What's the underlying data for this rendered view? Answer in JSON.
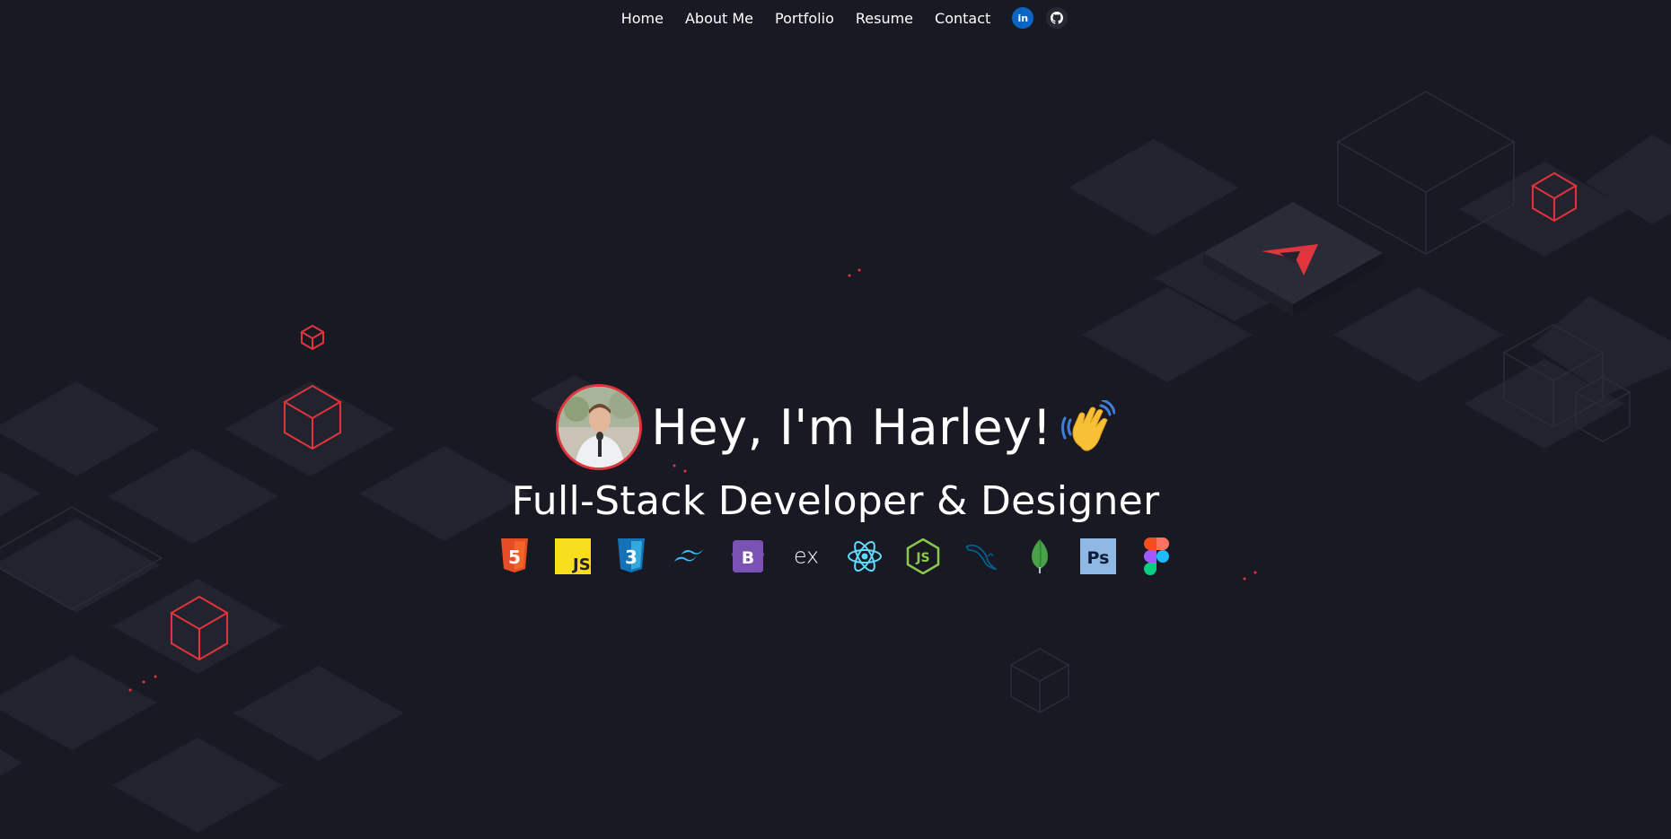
{
  "nav": {
    "items": [
      "Home",
      "About Me",
      "Portfolio",
      "Resume",
      "Contact"
    ],
    "social": [
      {
        "icon": "linkedin-icon",
        "label": "in",
        "color": "#0a66c2"
      },
      {
        "icon": "github-icon",
        "color": "#262832"
      }
    ]
  },
  "hero": {
    "greeting": "Hey, I'm Harley!",
    "emoji": "waving-hand-icon",
    "subtitle": "Full-Stack Developer & Designer",
    "avatar": "profile-photo"
  },
  "tech_icons": [
    {
      "icon": "html5-icon",
      "label": "5",
      "color": "#e44d26"
    },
    {
      "icon": "javascript-icon",
      "label": "JS",
      "color": "#f7df1e"
    },
    {
      "icon": "css3-icon",
      "label": "3",
      "color": "#1572b6"
    },
    {
      "icon": "tailwind-icon",
      "color": "#38bdf8"
    },
    {
      "icon": "bootstrap-icon",
      "label": "B",
      "color": "#7952b3"
    },
    {
      "icon": "express-icon",
      "label": "ex",
      "color": "#ffffff"
    },
    {
      "icon": "react-icon",
      "color": "#61dafb"
    },
    {
      "icon": "nodejs-icon",
      "label": "JS",
      "color": "#8cc84b"
    },
    {
      "icon": "mysql-icon",
      "color": "#00618a"
    },
    {
      "icon": "mongodb-icon",
      "color": "#47a248"
    },
    {
      "icon": "photoshop-icon",
      "label": "Ps",
      "color": "#8fb9e2"
    },
    {
      "icon": "figma-icon",
      "color": "#a259ff"
    }
  ],
  "colors": {
    "background": "#181922",
    "tile": "#23242f",
    "accent": "#e0353d"
  }
}
